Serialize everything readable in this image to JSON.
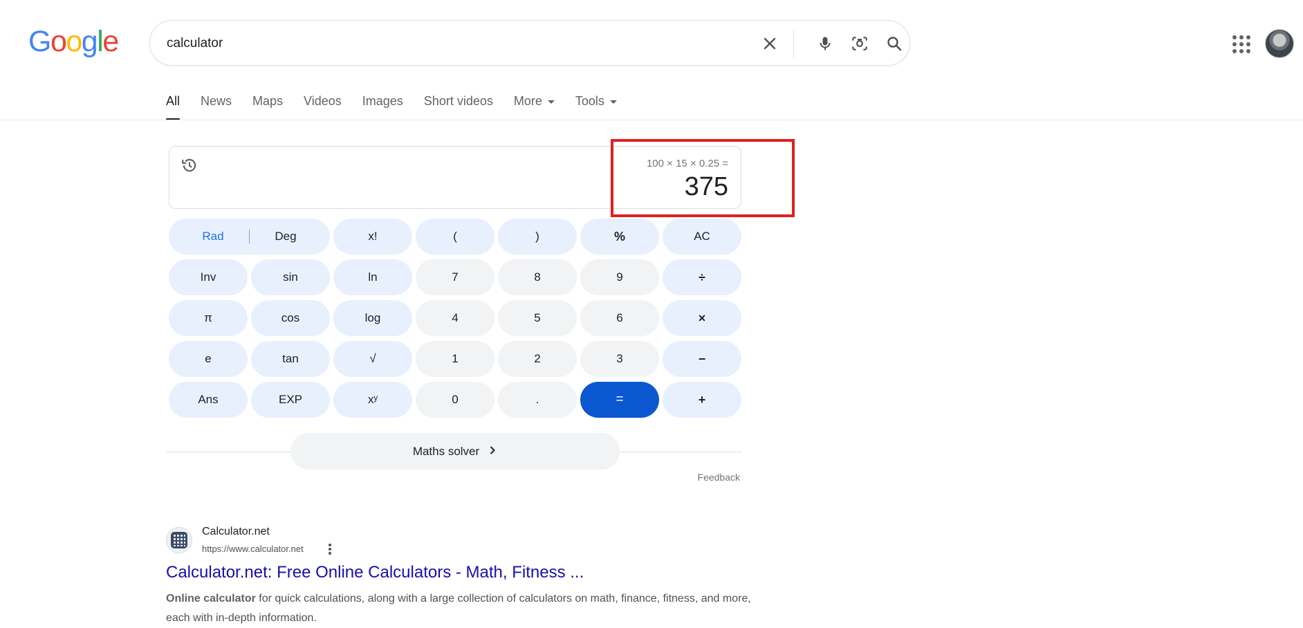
{
  "header": {
    "logo_letters": [
      {
        "ch": "G",
        "color": "#4285F4"
      },
      {
        "ch": "o",
        "color": "#EA4335"
      },
      {
        "ch": "o",
        "color": "#FBBC05"
      },
      {
        "ch": "g",
        "color": "#4285F4"
      },
      {
        "ch": "l",
        "color": "#34A853"
      },
      {
        "ch": "e",
        "color": "#EA4335"
      }
    ],
    "search_value": "calculator"
  },
  "tabs": [
    {
      "label": "All",
      "active": true
    },
    {
      "label": "News"
    },
    {
      "label": "Maps"
    },
    {
      "label": "Videos"
    },
    {
      "label": "Images"
    },
    {
      "label": "Short videos"
    },
    {
      "label": "More",
      "caret": true
    },
    {
      "label": "Tools",
      "caret": true
    }
  ],
  "calculator": {
    "expression": "100 × 15 × 0.25 =",
    "result": "375",
    "rad_label": "Rad",
    "deg_label": "Deg",
    "keys": [
      {
        "label": "x!",
        "style": "fn"
      },
      {
        "label": "(",
        "style": "fn"
      },
      {
        "label": ")",
        "style": "fn"
      },
      {
        "label": "%",
        "style": "fn-bold"
      },
      {
        "label": "AC",
        "style": "fn"
      },
      {
        "label": "Inv",
        "style": "fn"
      },
      {
        "label": "sin",
        "style": "fn"
      },
      {
        "label": "ln",
        "style": "fn"
      },
      {
        "label": "7",
        "style": "num"
      },
      {
        "label": "8",
        "style": "num"
      },
      {
        "label": "9",
        "style": "num"
      },
      {
        "label": "÷",
        "style": "fn-bold"
      },
      {
        "label": "π",
        "style": "fn"
      },
      {
        "label": "cos",
        "style": "fn"
      },
      {
        "label": "log",
        "style": "fn"
      },
      {
        "label": "4",
        "style": "num"
      },
      {
        "label": "5",
        "style": "num"
      },
      {
        "label": "6",
        "style": "num"
      },
      {
        "label": "×",
        "style": "fn-bold"
      },
      {
        "label": "e",
        "style": "fn"
      },
      {
        "label": "tan",
        "style": "fn"
      },
      {
        "label": "√",
        "style": "fn"
      },
      {
        "label": "1",
        "style": "num"
      },
      {
        "label": "2",
        "style": "num"
      },
      {
        "label": "3",
        "style": "num"
      },
      {
        "label": "−",
        "style": "fn-bold"
      },
      {
        "label": "Ans",
        "style": "fn"
      },
      {
        "label": "EXP",
        "style": "fn"
      },
      {
        "label": "xʸ",
        "style": "fn"
      },
      {
        "label": "0",
        "style": "num"
      },
      {
        "label": ".",
        "style": "num"
      },
      {
        "label": "=",
        "style": "eq"
      },
      {
        "label": "+",
        "style": "fn-bold"
      }
    ],
    "solver_label": "Maths solver",
    "feedback_label": "Feedback",
    "highlight_color": "#e02020"
  },
  "result": {
    "site_name": "Calculator.net",
    "url": "https://www.calculator.net",
    "title": "Calculator.net: Free Online Calculators - Math, Fitness ...",
    "snippet_bold": "Online calculator",
    "snippet_rest": " for quick calculations, along with a large collection of calculators on math, finance, fitness, and more, each with in-depth information."
  }
}
